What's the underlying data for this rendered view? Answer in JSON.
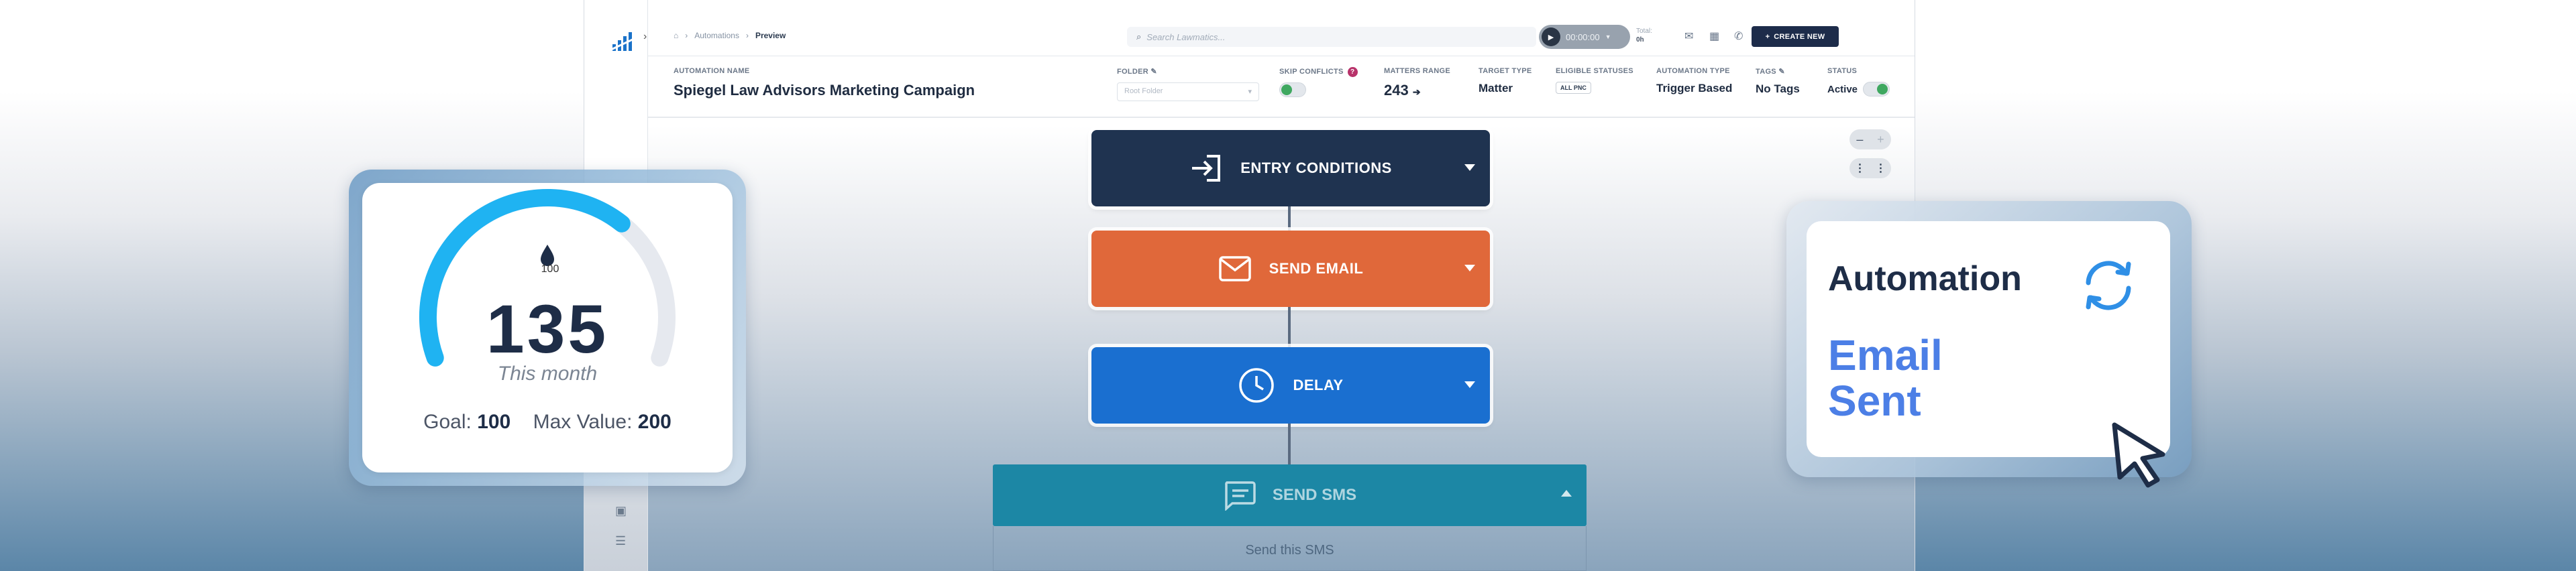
{
  "topbar": {
    "breadcrumb": {
      "home_icon": "home-icon",
      "section": "Automations",
      "current": "Preview"
    },
    "search_placeholder": "Search Lawmatics...",
    "timer": "00:00:00",
    "total_label": "Total:",
    "total_value": "0h",
    "create_label": "CREATE NEW"
  },
  "info": {
    "name_label": "AUTOMATION NAME",
    "name_value": "Spiegel Law Advisors Marketing Campaign",
    "folder_label": "FOLDER",
    "folder_placeholder": "Root Folder",
    "skip_label": "SKIP CONFLICTS",
    "matters_label": "MATTERS RANGE",
    "matters_value": "243",
    "target_label": "TARGET TYPE",
    "target_value": "Matter",
    "eligible_label": "ELIGIBLE STATUSES",
    "eligible_value": "ALL PNC",
    "type_label": "AUTOMATION TYPE",
    "type_value": "Trigger Based",
    "tags_label": "TAGS",
    "tags_value": "No Tags",
    "status_label": "STATUS",
    "status_value": "Active"
  },
  "flow": {
    "nodes": [
      {
        "label": "ENTRY CONDITIONS",
        "color": "#1f3350",
        "icon": "enter-icon"
      },
      {
        "label": "SEND EMAIL",
        "color": "#e0683a",
        "icon": "envelope-icon"
      },
      {
        "label": "DELAY",
        "color": "#1a6fd0",
        "icon": "clock-icon"
      }
    ],
    "sms_label": "SEND SMS",
    "sms_body": "Send this SMS",
    "zoom_minus": "–",
    "zoom_plus": "+"
  },
  "gauge": {
    "value": "135",
    "subtitle": "This month",
    "goal_label": "Goal:",
    "goal_value": "100",
    "max_label": "Max Value:",
    "max_value": "200",
    "marker_label": "100",
    "level": 0.675,
    "track_color": "#e6e9ef",
    "fill_color": "#1fb3f2"
  },
  "automation_card": {
    "title": "Automation",
    "line1": "Email",
    "line2": "Sent",
    "accent": "#4c7fe6",
    "icon": "sync-icon"
  }
}
